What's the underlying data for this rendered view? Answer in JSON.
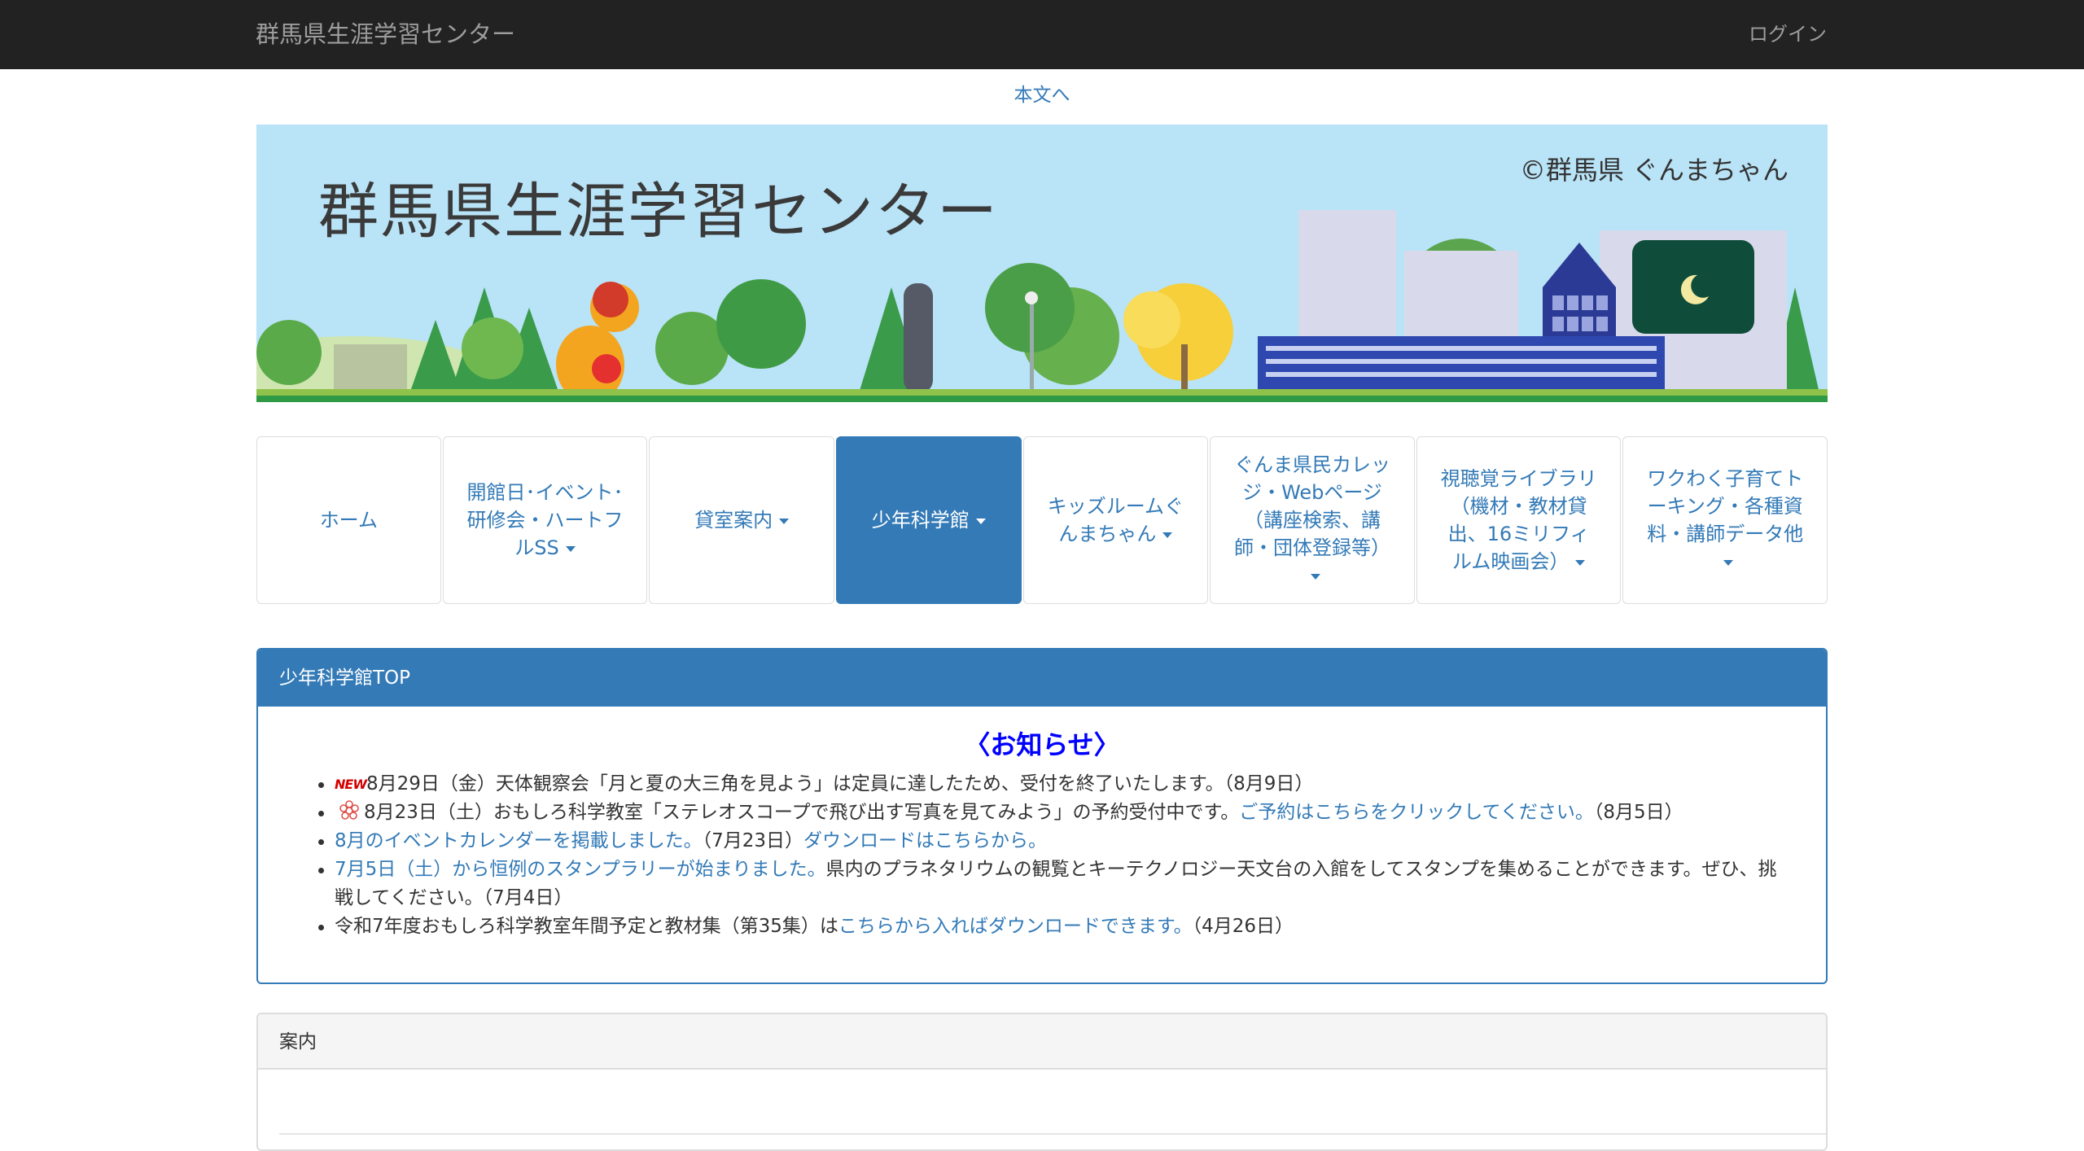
{
  "header": {
    "site_title": "群馬県生涯学習センター",
    "login_label": "ログイン"
  },
  "skip_link": "本文へ",
  "banner": {
    "title": "群馬県生涯学習センター",
    "credit": "©群馬県 ぐんまちゃん"
  },
  "nav": {
    "items": [
      {
        "label": "ホーム",
        "caret": false
      },
      {
        "label": "開館日･イベント･研修会・ハートフルSS",
        "caret": true
      },
      {
        "label": "貸室案内",
        "caret": true
      },
      {
        "label": "少年科学館",
        "caret": true,
        "active": true
      },
      {
        "label": "キッズルームぐんまちゃん",
        "caret": true
      },
      {
        "label": "ぐんま県民カレッジ・Webページ（講座検索、講師・団体登録等）",
        "caret": true
      },
      {
        "label": "視聴覚ライブラリ（機材・教材貸出、16ミリフィルム映画会）",
        "caret": true
      },
      {
        "label": "ワクわく子育てトーキング・各種資料・講師データ他",
        "caret": true
      }
    ]
  },
  "science_panel": {
    "heading": "少年科学館TOP",
    "notice_title": "〈お知らせ〉",
    "notices": {
      "n1": {
        "badge": "NEW",
        "text": "8月29日（金）天体観察会「月と夏の大三角を見よう」は定員に達したため、受付を終了いたします。（8月9日）"
      },
      "n2": {
        "text": "8月23日（土）おもしろ科学教室「ステレオスコープで飛び出す写真を見てみよう」の予約受付中です。",
        "link": "ご予約はこちらをクリックしてください。",
        "date": "（8月5日）"
      },
      "n3": {
        "link1": "8月のイベントカレンダーを掲載しました。",
        "mid": "（7月23日）",
        "link2": "ダウンロードはこちらから。"
      },
      "n4": {
        "link": "7月5日（土）から恒例のスタンプラリーが始まりました。",
        "text": "県内のプラネタリウムの観覧とキーテクノロジー天文台の入館をしてスタンプを集めることができます。ぜひ、挑戦してください。（7月4日）"
      },
      "n5": {
        "text": "令和7年度おもしろ科学教室年間予定と教材集（第35集）は",
        "link": "こちらから入ればダウンロードできます。",
        "date": "（4月26日）"
      }
    }
  },
  "guide_panel": {
    "heading": "案内"
  },
  "colors": {
    "navbar": "#222222",
    "primary": "#337ab7",
    "notice_title": "#0000ff",
    "new_badge": "#d40000",
    "banner_sky": "#b9e3f6"
  }
}
